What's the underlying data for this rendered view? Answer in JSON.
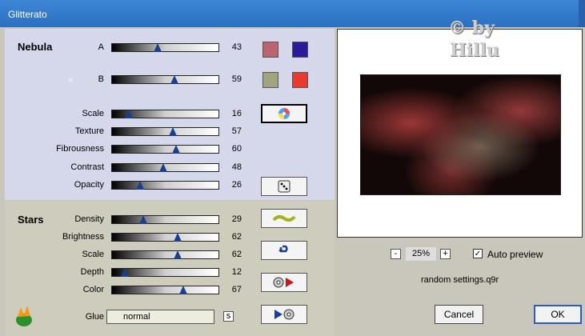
{
  "window": {
    "title": "Glitterato"
  },
  "nebula": {
    "title": "Nebula",
    "sliders": [
      {
        "label": "A",
        "value": "43"
      },
      {
        "label": "B",
        "value": "59"
      },
      {
        "label": "Scale",
        "value": "16"
      },
      {
        "label": "Texture",
        "value": "57"
      },
      {
        "label": "Fibrousness",
        "value": "60"
      },
      {
        "label": "Contrast",
        "value": "48"
      },
      {
        "label": "Opacity",
        "value": "26"
      }
    ],
    "colors": {
      "a1": "#bc6371",
      "a2": "#2a1a9a",
      "b1": "#a3a581",
      "b2": "#ea3a2f"
    }
  },
  "stars": {
    "title": "Stars",
    "sliders": [
      {
        "label": "Density",
        "value": "29"
      },
      {
        "label": "Brightness",
        "value": "62"
      },
      {
        "label": "Scale",
        "value": "62"
      },
      {
        "label": "Depth",
        "value": "12"
      },
      {
        "label": "Color",
        "value": "67"
      }
    ],
    "glue_label": "Glue",
    "glue_value": "normal",
    "glue_stepper": "s"
  },
  "preview": {
    "watermark_line1": "© by",
    "watermark_line2": "Hillu",
    "zoom_minus": "-",
    "zoom_value": "25%",
    "zoom_plus": "+",
    "auto_preview_label": "Auto preview",
    "auto_preview_checked": "✓",
    "settings_file": "random settings.q9r"
  },
  "buttons": {
    "cancel": "Cancel",
    "ok": "OK"
  }
}
